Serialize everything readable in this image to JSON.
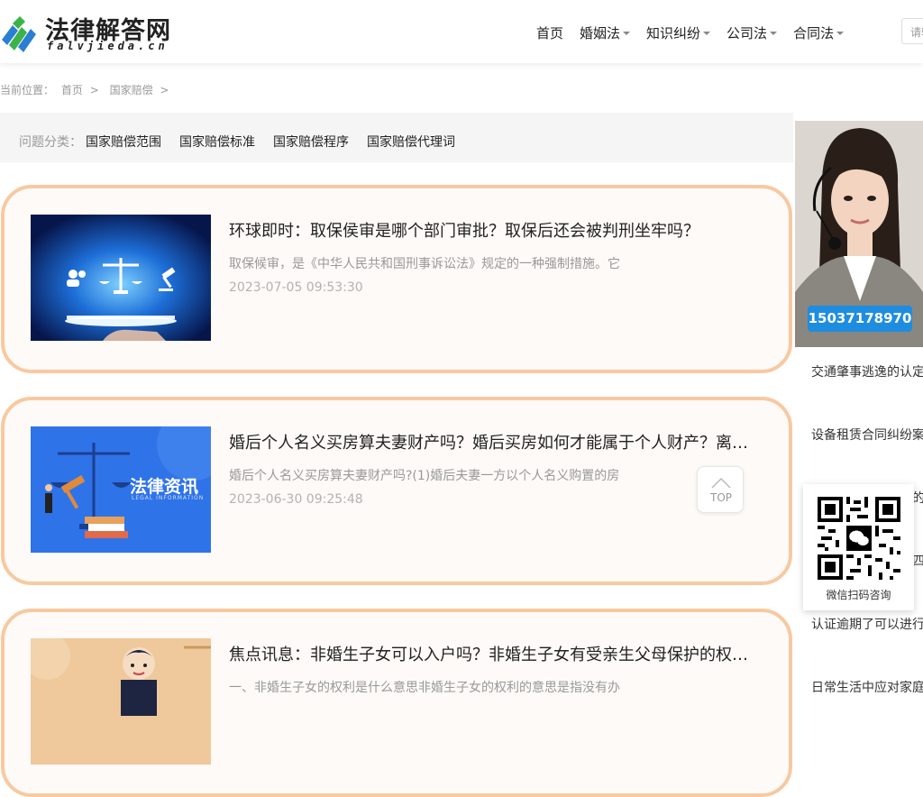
{
  "header": {
    "logo_cn": "法律解答网",
    "logo_en": "falvjieda.cn",
    "nav": [
      {
        "label": "首页",
        "has_dropdown": false
      },
      {
        "label": "婚姻法",
        "has_dropdown": true
      },
      {
        "label": "知识纠纷",
        "has_dropdown": true
      },
      {
        "label": "公司法",
        "has_dropdown": true
      },
      {
        "label": "合同法",
        "has_dropdown": true
      }
    ],
    "search_placeholder": "请输"
  },
  "breadcrumb": {
    "prefix": "当前位置：",
    "items": [
      "首页",
      "国家赔偿"
    ],
    "separator": ">"
  },
  "category": {
    "label": "问题分类：",
    "links": [
      "国家赔偿范围",
      "国家赔偿标准",
      "国家赔偿程序",
      "国家赔偿代理词"
    ]
  },
  "articles": [
    {
      "title": "环球即时：取保侯审是哪个部门审批？取保后还会被判刑坐牢吗？",
      "summary": "取保候审，是《中华人民共和国刑事诉讼法》规定的一种强制措施。它",
      "date": "2023-07-05 09:53:30",
      "thumb_icon": "justice-scales-icon"
    },
    {
      "title": "婚后个人名义买房算夫妻财产吗？婚后买房如何才能属于个人财产？离婚后怎么分割",
      "summary": "婚后个人名义买房算夫妻财产吗?(1)婚后夫妻一方以个人名义购置的房",
      "date": "2023-06-30 09:25:48",
      "thumb_text": "法律资讯",
      "thumb_subtext": "LEGAL INFORMATION"
    },
    {
      "title": "焦点讯息：非婚生子女可以入户吗？非婚生子女有受亲生父母保护的权利吗？",
      "summary": "一、非婚生子女的权利是什么意思非婚生子女的权利的意思是指没有办",
      "date": "",
      "thumb_icon": "lawyer-cartoon-icon"
    }
  ],
  "top_button": {
    "label": "TOP"
  },
  "sidebar": {
    "agent_phone": "15037178970",
    "list": [
      "交通肇事逃逸的认定",
      "设备租赁合同纠纷案",
      "的",
      "四",
      "认证逾期了可以进行",
      "日常生活中应对家庭"
    ]
  },
  "qr": {
    "label": "微信扫码咨询"
  },
  "colors": {
    "card_border": "#f8c9a0",
    "card_bg": "#fdfaf7",
    "phone_badge": "#1e8de0",
    "logo_green": "#3cb34a",
    "logo_blue": "#2a7fd4"
  }
}
